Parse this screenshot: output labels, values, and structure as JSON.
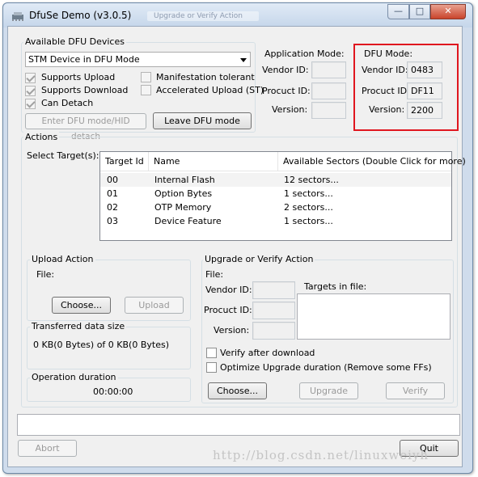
{
  "window": {
    "title": "DfuSe Demo (v3.0.5)",
    "blurred_title": "Upgrade or Verify Action"
  },
  "devices": {
    "group_label": "Available DFU Devices",
    "selected_device": "STM Device in DFU Mode",
    "supports_upload": "Supports Upload",
    "supports_download": "Supports Download",
    "can_detach": "Can Detach",
    "manifestation_tolerant": "Manifestation tolerant",
    "accelerated_upload": "Accelerated Upload (ST)",
    "enter_dfu_button": "Enter DFU mode/HID detach",
    "leave_dfu_button": "Leave DFU mode"
  },
  "app_mode": {
    "label": "Application Mode:",
    "vendor_label": "Vendor ID:",
    "product_label": "Procuct ID:",
    "version_label": "Version:",
    "vendor_value": "",
    "product_value": "",
    "version_value": ""
  },
  "dfu_mode": {
    "label": "DFU Mode:",
    "vendor_label": "Vendor ID:",
    "product_label": "Procuct ID:",
    "version_label": "Version:",
    "vendor_value": "0483",
    "product_value": "DF11",
    "version_value": "2200",
    "highlight_color": "#e0161f"
  },
  "actions": {
    "group_label": "Actions",
    "select_targets": "Select Target(s):",
    "columns": [
      "Target Id",
      "Name",
      "Available Sectors (Double Click for more)"
    ],
    "rows": [
      {
        "id": "00",
        "name": "Internal Flash",
        "sectors": "12 sectors..."
      },
      {
        "id": "01",
        "name": "Option Bytes",
        "sectors": "1 sectors..."
      },
      {
        "id": "02",
        "name": "OTP Memory",
        "sectors": "2 sectors..."
      },
      {
        "id": "03",
        "name": "Device Feature",
        "sectors": "1 sectors..."
      }
    ]
  },
  "upload": {
    "group_label": "Upload Action",
    "file_label": "File:",
    "choose_button": "Choose...",
    "upload_button": "Upload"
  },
  "transferred": {
    "group_label": "Transferred data size",
    "value": "0 KB(0 Bytes) of 0 KB(0 Bytes)"
  },
  "duration": {
    "group_label": "Operation duration",
    "value": "00:00:00"
  },
  "upgrade": {
    "group_label": "Upgrade or Verify Action",
    "file_label": "File:",
    "vendor_label": "Vendor ID:",
    "product_label": "Procuct ID:",
    "version_label": "Version:",
    "targets_label": "Targets in file:",
    "verify_after": "Verify after download",
    "optimize": "Optimize Upgrade duration (Remove some FFs)",
    "choose_button": "Choose...",
    "upgrade_button": "Upgrade",
    "verify_button": "Verify"
  },
  "footer": {
    "abort_button": "Abort",
    "quit_button": "Quit",
    "status_text": ""
  },
  "watermark": "http://blog.csdn.net/linuxweiyh"
}
